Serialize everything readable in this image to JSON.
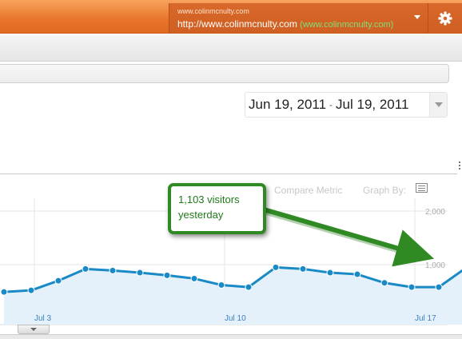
{
  "account": {
    "name": "www.colinmcnulty.com",
    "url": "http://www.colinmcnulty.com",
    "profile": "(www.colinmcnulty.com)"
  },
  "icons": {
    "settings": "gear-icon",
    "account_menu": "caret-down-icon",
    "graph_by": "table-icon"
  },
  "date_range": {
    "start": "Jun 19, 2011",
    "separator": "-",
    "end": "Jul 19, 2011"
  },
  "chart_controls": {
    "compare_metric": "Compare Metric",
    "graph_by": "Graph By:"
  },
  "callout": {
    "line1": "1,103 visitors",
    "line2": "yesterday"
  },
  "colors": {
    "header": "#e8742a",
    "line": "#1a8ac6",
    "fill": "#e4f1fa",
    "callout": "#2f8a24"
  },
  "chart_data": {
    "type": "line",
    "title": "",
    "series": [
      {
        "values": [
          490,
          520,
          700,
          920,
          890,
          850,
          800,
          740,
          620,
          580,
          950,
          920,
          850,
          820,
          660,
          580,
          580,
          940,
          1103
        ]
      }
    ],
    "x_tick_labels": [
      {
        "label": "Jul 3",
        "index": 1
      },
      {
        "label": "Jul 10",
        "index": 8
      },
      {
        "label": "Jul 17",
        "index": 15
      }
    ],
    "y_ticks": [
      "1,000",
      "2,000"
    ],
    "ylim": [
      0,
      2000
    ],
    "annotation": "1,103 visitors yesterday"
  }
}
